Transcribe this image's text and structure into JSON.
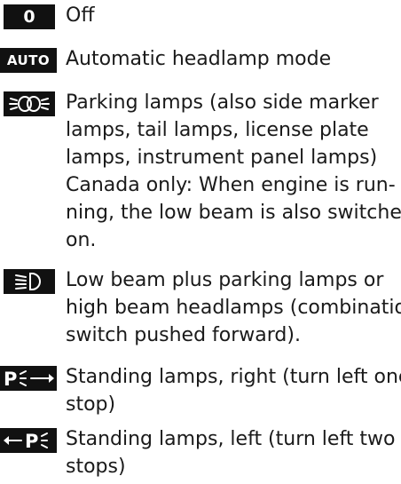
{
  "entries": [
    {
      "id": "off",
      "symbol": {
        "kind": "text",
        "text": "0",
        "icon": "zero-symbol"
      },
      "lines": [
        "Off"
      ]
    },
    {
      "id": "auto",
      "symbol": {
        "kind": "text",
        "text": "AUTO",
        "icon": "auto-symbol"
      },
      "lines": [
        "Automatic headlamp mode"
      ]
    },
    {
      "id": "parking",
      "symbol": {
        "kind": "icon",
        "icon": "parking-lamps-icon"
      },
      "lines": [
        "Parking lamps (also side marker",
        "lamps, tail lamps, license plate",
        "lamps, instrument panel lamps)",
        "Canada only: When engine is run-",
        "ning, the low beam is also switched",
        "on."
      ]
    },
    {
      "id": "low-beam",
      "symbol": {
        "kind": "icon",
        "icon": "low-beam-icon"
      },
      "lines": [
        "Low beam plus parking lamps or",
        "high beam headlamps (combination",
        "switch pushed forward)."
      ]
    },
    {
      "id": "standing-right",
      "symbol": {
        "kind": "icon",
        "icon": "standing-lamps-right-icon"
      },
      "lines": [
        "Standing lamps, right (turn left one",
        "stop)"
      ]
    },
    {
      "id": "standing-left",
      "symbol": {
        "kind": "icon",
        "icon": "standing-lamps-left-icon"
      },
      "lines": [
        "Standing lamps, left (turn left two",
        "stops)"
      ]
    }
  ],
  "colors": {
    "badge": "#111111",
    "glyph": "#ffffff",
    "text": "#1a1a1a"
  }
}
